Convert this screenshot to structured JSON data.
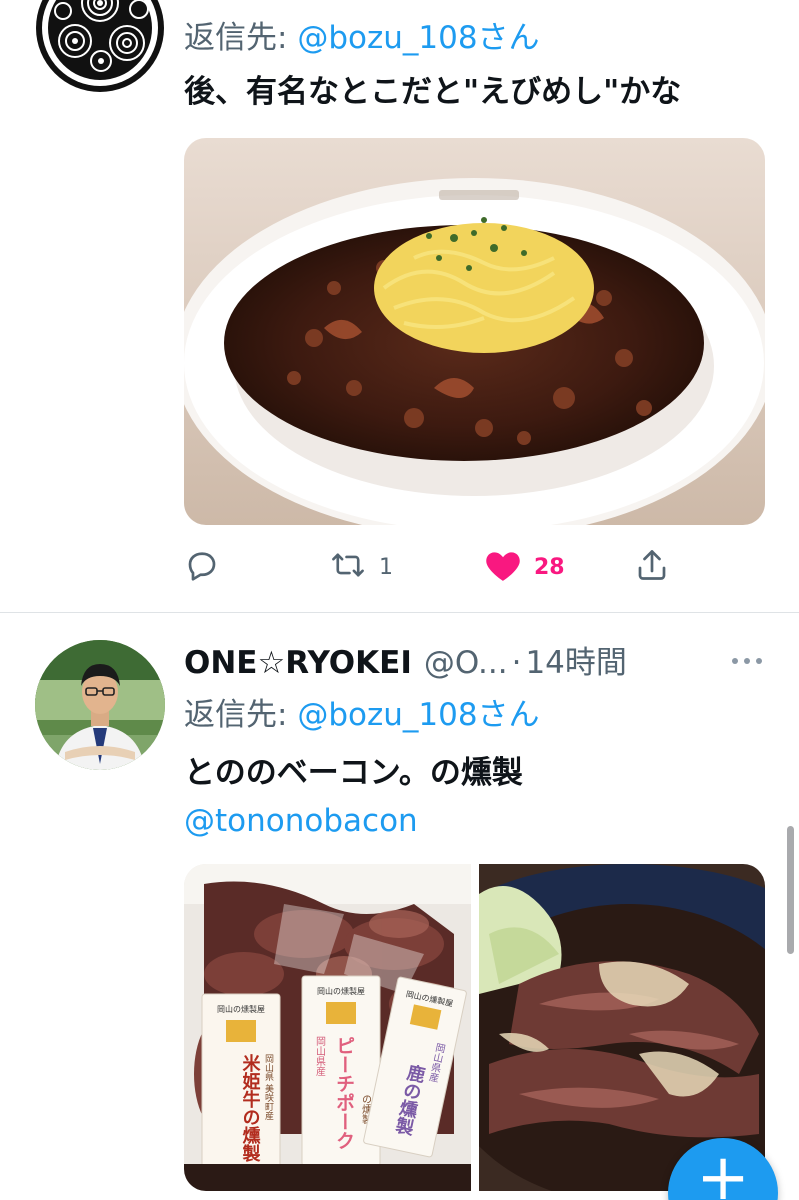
{
  "tweet1": {
    "reply_prefix": "返信先: ",
    "reply_mention": "@bozu_108さん",
    "text": "後、有名なとこだと\"えびめし\"かな",
    "media_alt": "ebimeshi",
    "actions": {
      "reply_count": "",
      "retweet_count": "1",
      "like_count": "28"
    }
  },
  "tweet2": {
    "name": "ONE☆RYOKEI",
    "handle": "@O...",
    "separator": "·",
    "time": "14時間",
    "reply_prefix": "返信先: ",
    "reply_mention": "@bozu_108さん",
    "text": "とののベーコン。の燻製",
    "link": "@tononobacon",
    "labels": {
      "label1_top": "岡山の燻製屋",
      "label1_body": "米姫牛の燻製",
      "label1_side": "岡山県 美咲町産",
      "label2_top": "岡山の燻製屋",
      "label2_side": "岡山県産",
      "label2_body": "ピーチポーク",
      "label2_suffix": "の燻製",
      "label3_top": "岡山の燻製屋",
      "label3_side": "岡山県産",
      "label3_body": "鹿の燻製"
    }
  },
  "fab": {
    "label": "+"
  },
  "colors": {
    "accent": "#1d9bf0",
    "like": "#f91880",
    "muted": "#536471"
  }
}
